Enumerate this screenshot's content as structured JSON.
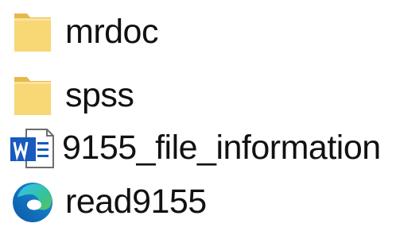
{
  "files": [
    {
      "name": "mrdoc",
      "icon": "folder-icon"
    },
    {
      "name": "spss",
      "icon": "folder-icon"
    },
    {
      "name": "9155_file_information",
      "icon": "word-document-icon"
    },
    {
      "name": "read9155",
      "icon": "edge-browser-icon"
    }
  ],
  "colors": {
    "folder_front": "#F8D775",
    "folder_back": "#E8B84A",
    "word_blue": "#185ABD",
    "edge_blue": "#0C59A4",
    "edge_teal": "#35C1F1",
    "edge_green": "#5EC35A"
  }
}
